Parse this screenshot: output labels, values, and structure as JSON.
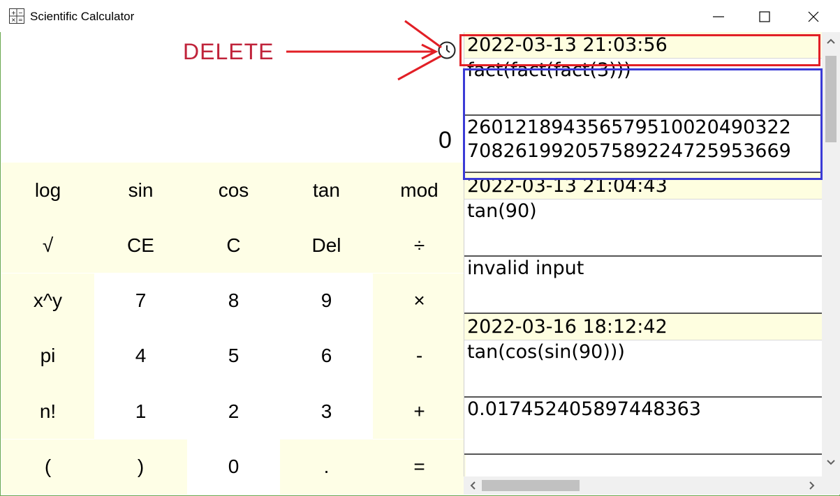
{
  "window": {
    "title": "Scientific Calculator",
    "minimize_glyph": "—",
    "maximize_glyph": "☐",
    "close_glyph": "✕"
  },
  "display": {
    "value": "0"
  },
  "keypad": {
    "rows": [
      [
        "log",
        "sin",
        "cos",
        "tan",
        "mod"
      ],
      [
        "√",
        "CE",
        "C",
        "Del",
        "÷"
      ],
      [
        "x^y",
        "7",
        "8",
        "9",
        "×"
      ],
      [
        "pi",
        "4",
        "5",
        "6",
        "-"
      ],
      [
        "n!",
        "1",
        "2",
        "3",
        "+"
      ],
      [
        "(",
        ")",
        "0",
        ".",
        "="
      ]
    ]
  },
  "history": {
    "entries": [
      {
        "timestamp": "2022-03-13 21:03:56",
        "expression": "fact(fact(fact(3)))",
        "result": "260121894356579510020490322\n708261992057589224725953669"
      },
      {
        "timestamp": "2022-03-13 21:04:43",
        "expression": "tan(90)",
        "result": "invalid input"
      },
      {
        "timestamp": "2022-03-16 18:12:42",
        "expression": "tan(cos(sin(90)))",
        "result": "0.017452405897448363"
      }
    ]
  },
  "annotation": {
    "label": "DELETE",
    "label_color": "#c0233a",
    "timestamp_box_color": "#e21f26",
    "entry_box_color": "#3b3bd6"
  },
  "colors": {
    "keypad_function_bg": "#fefee6",
    "keypad_digit_bg": "#ffffff",
    "history_date_bg": "#fefee0"
  }
}
